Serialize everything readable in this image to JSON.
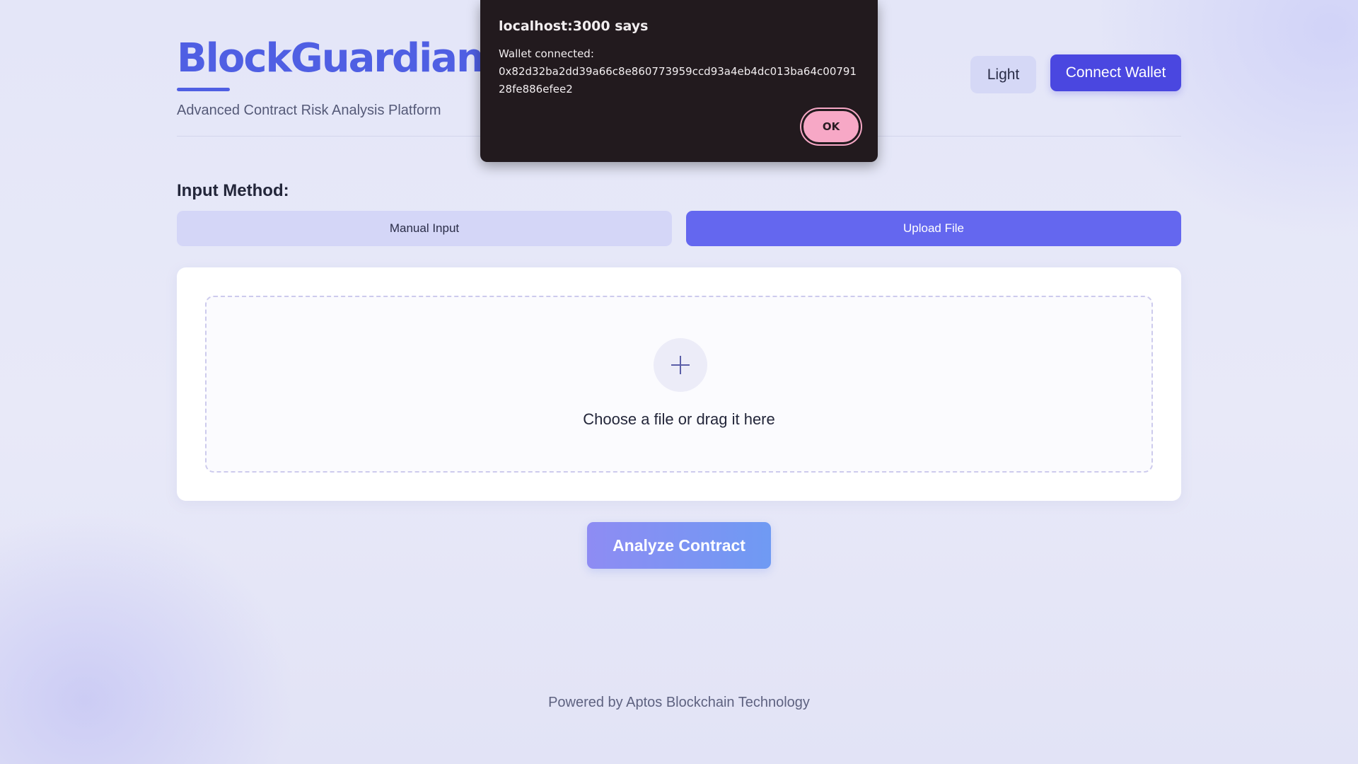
{
  "header": {
    "title": "BlockGuardian",
    "subtitle": "Advanced Contract Risk Analysis Platform",
    "theme_toggle_label": "Light",
    "connect_wallet_label": "Connect Wallet"
  },
  "input_method": {
    "label": "Input Method:",
    "tabs": [
      {
        "label": "Manual Input",
        "active": false
      },
      {
        "label": "Upload File",
        "active": true
      }
    ]
  },
  "upload": {
    "icon": "plus-icon",
    "prompt": "Choose a file or drag it here"
  },
  "analyze_button_label": "Analyze Contract",
  "footer": {
    "text": "Powered by Aptos Blockchain Technology"
  },
  "alert": {
    "title": "localhost:3000 says",
    "message_line1": "Wallet connected:",
    "message_address": "0x82d32ba2dd39a66c8e860773959ccd93a4eb4dc013ba64c0079128fe886efee2",
    "ok_label": "OK"
  },
  "colors": {
    "brand": "#4f5fe3",
    "connect_wallet": "#4a47e0",
    "active_tab": "#6467ef",
    "inactive_tab": "#d4d6f7",
    "alert_background": "#221a1e",
    "alert_ok": "#f7a8c6"
  }
}
